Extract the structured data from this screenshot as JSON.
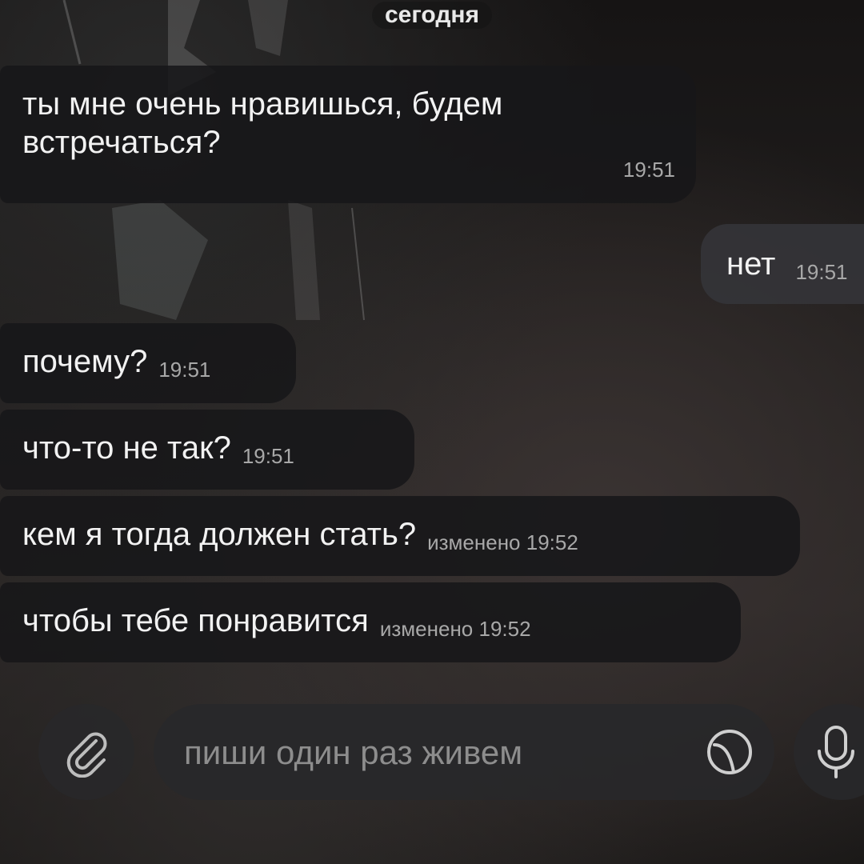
{
  "chat": {
    "date_label": "сегодня",
    "messages": [
      {
        "direction": "incoming",
        "text": "ты мне очень нравишься, будем встречаться?",
        "time": "19:51",
        "edited_label": ""
      },
      {
        "direction": "outgoing",
        "text": "нет",
        "time": "19:51",
        "edited_label": ""
      },
      {
        "direction": "incoming",
        "text": "почему?",
        "time": "19:51",
        "edited_label": ""
      },
      {
        "direction": "incoming",
        "text": "что-то не так?",
        "time": "19:51",
        "edited_label": ""
      },
      {
        "direction": "incoming",
        "text": "кем я тогда должен стать?",
        "time": "19:52",
        "edited_label": "изменено"
      },
      {
        "direction": "incoming",
        "text": "чтобы тебе понравится",
        "time": "19:52",
        "edited_label": "изменено"
      }
    ]
  },
  "input_bar": {
    "placeholder": "пиши один раз живем",
    "icons": {
      "attach": "paperclip-icon",
      "sticker": "sticker-icon",
      "voice": "microphone-icon"
    }
  },
  "colors": {
    "bubble_incoming": "#171719",
    "bubble_outgoing": "#343438",
    "text": "#f2f2f2",
    "meta_text": "#a8a8a8"
  }
}
